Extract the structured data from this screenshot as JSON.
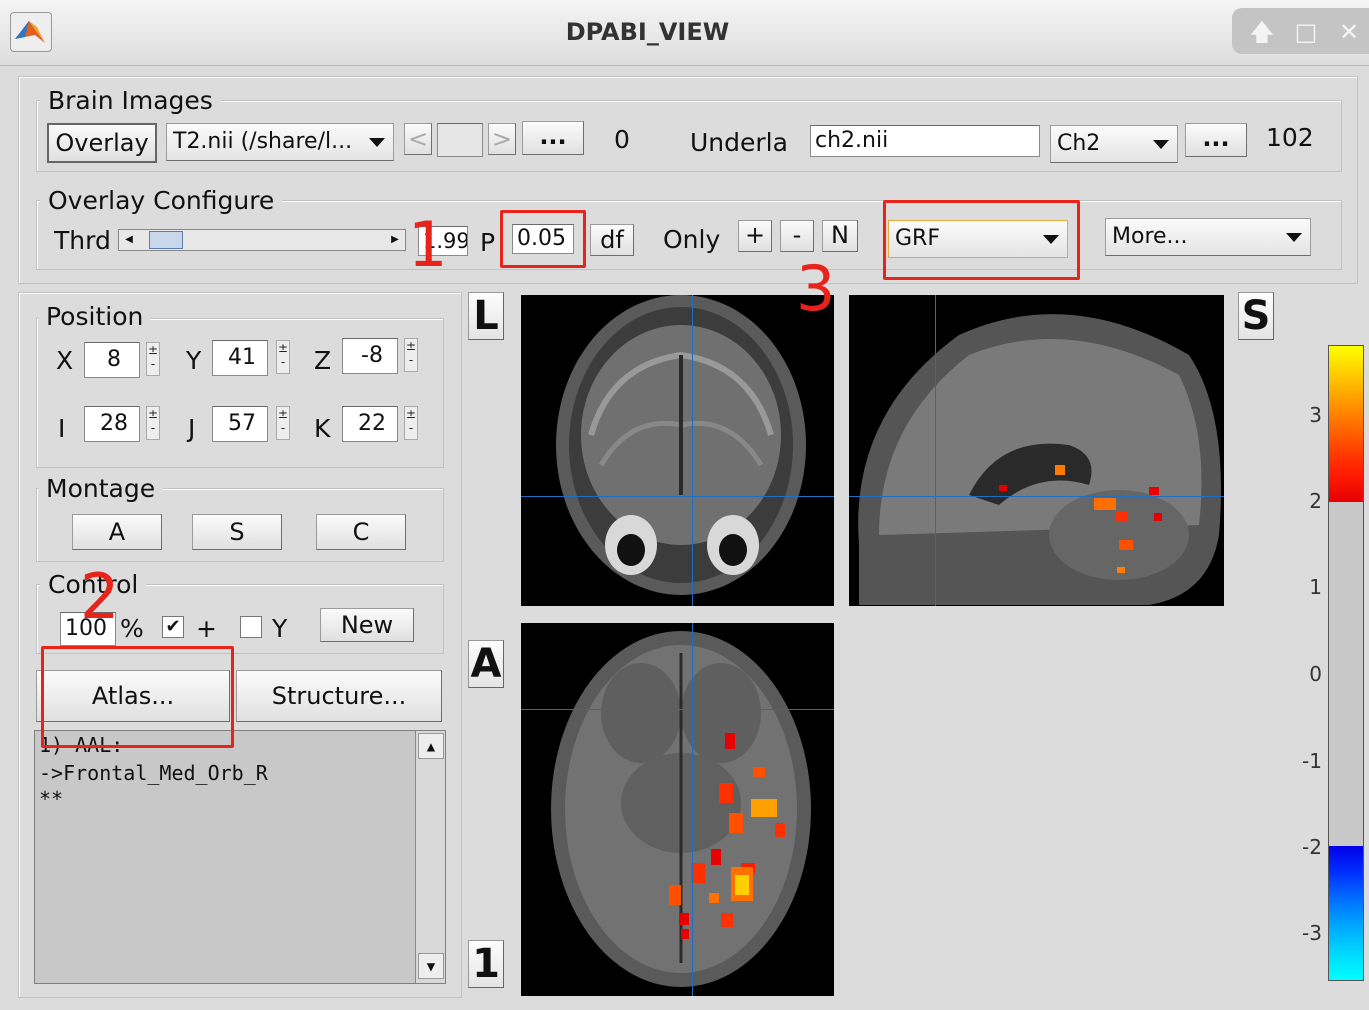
{
  "window": {
    "title": "DPABI_VIEW",
    "minimize": "🡅",
    "maximize": "□",
    "close": "✕"
  },
  "brain_images": {
    "group_label": "Brain Images",
    "overlay_button": "Overlay",
    "overlay_file": "T2.nii (/share/l...",
    "prev": "<",
    "next": ">",
    "browse": "...",
    "overlay_count": "0",
    "underlay_label": "Underla",
    "underlay_file": "ch2.nii",
    "underlay_template": "Ch2",
    "underlay_browse": "...",
    "underlay_value": "102"
  },
  "overlay_configure": {
    "group_label": "Overlay Configure",
    "thrd_label": "Thrd",
    "thrd_value": "1.99",
    "p_label": "P",
    "p_value": "0.05",
    "df_button": "df",
    "only_label": "Only",
    "only_plus": "+",
    "only_minus": "-",
    "only_n": "N",
    "correction": "GRF",
    "more": "More..."
  },
  "position": {
    "group_label": "Position",
    "x_label": "X",
    "x": "8",
    "y_label": "Y",
    "y": "41",
    "z_label": "Z",
    "z": "-8",
    "i_label": "I",
    "i": "28",
    "j_label": "J",
    "j": "57",
    "k_label": "K",
    "k": "22"
  },
  "montage": {
    "group_label": "Montage",
    "a": "A",
    "s": "S",
    "c": "C"
  },
  "control": {
    "group_label": "Control",
    "zoom": "100",
    "percent": "%",
    "crosshair_label": "+",
    "crosshair_checked": true,
    "y_label": "Y",
    "y_checked": false,
    "new_button": "New",
    "atlas_button": "Atlas...",
    "structure_button": "Structure..."
  },
  "atlas_output": {
    "line1": "1) AAL:",
    "line2": "->Frontal_Med_Orb_R",
    "line3": "**"
  },
  "views": {
    "coronal_label": "L",
    "sagittal_label": "S",
    "axial_label": "A",
    "montage_index": "1"
  },
  "colorbar": {
    "ticks": [
      "3",
      "2",
      "1",
      "0",
      "-1",
      "-2",
      "-3"
    ],
    "positive_colors": [
      "#ffff00",
      "#ffd000",
      "#ffa000",
      "#ff7000",
      "#ff4000",
      "#ff1a00",
      "#e60000"
    ],
    "negative_colors": [
      "#0000e6",
      "#0030ff",
      "#0070ff",
      "#00a8ff",
      "#00d8ff",
      "#00ffff"
    ],
    "mid_color": "#c8c8c8"
  },
  "annotations": {
    "n1": "1",
    "n2": "2",
    "n3": "3",
    "color": "#e8231b"
  }
}
